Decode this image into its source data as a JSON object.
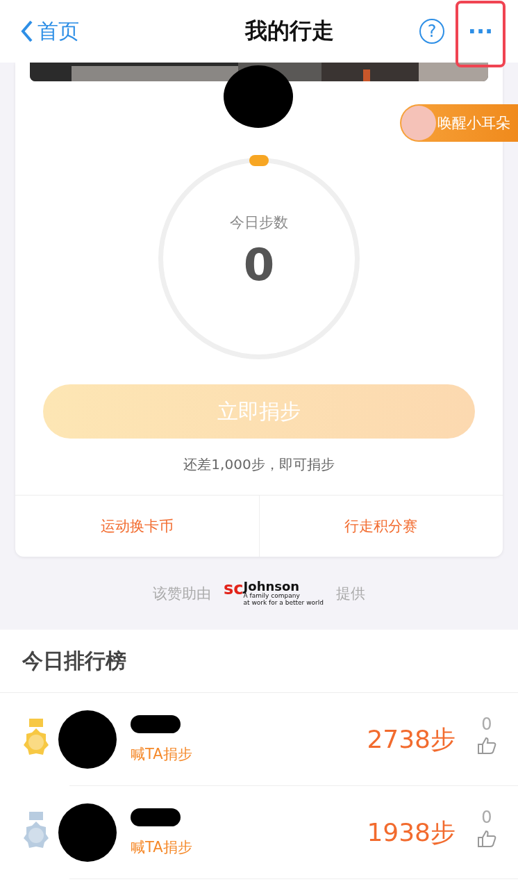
{
  "nav": {
    "back": "首页",
    "title": "我的行走",
    "help": "?",
    "more": "···",
    "more_highlighted": true
  },
  "badge": {
    "label": "唤醒小耳朵"
  },
  "steps": {
    "label": "今日步数",
    "value": "0"
  },
  "donate": {
    "label": "立即捐步",
    "disabled": true,
    "hint": "还差1,000步，即可捐步"
  },
  "links": [
    "运动换卡币",
    "行走积分赛"
  ],
  "sponsor": {
    "before": "该赞助由",
    "logo_main": "sc",
    "logo_brand": "Johnson",
    "logo_line1": "A family company",
    "logo_line2": "at work for a better world",
    "after": "提供"
  },
  "ranking": {
    "title": "今日排行榜",
    "rows": [
      {
        "color": "#f7c843",
        "action": "喊TA捐步",
        "steps": "2738步",
        "likes": "0"
      },
      {
        "color": "#b8cce0",
        "action": "喊TA捐步",
        "steps": "1938步",
        "likes": "0"
      }
    ]
  }
}
